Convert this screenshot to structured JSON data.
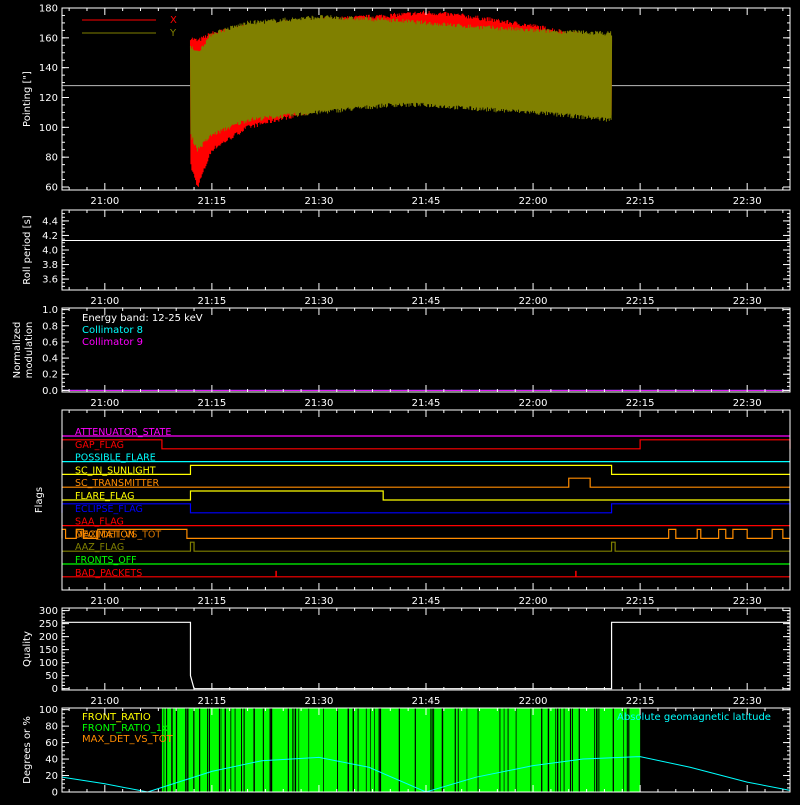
{
  "colors": {
    "background": "#000000",
    "axes": "#ffffff",
    "x_series": "#ff0000",
    "y_series": "#808000",
    "cyan": "#00ffff",
    "magenta": "#ff00ff",
    "green": "#00ff00",
    "orange": "#ff8c00",
    "yellow": "#ffff00",
    "blue": "#0000ff",
    "red": "#ff0000"
  },
  "chart_data": [
    {
      "type": "line",
      "id": "pointing",
      "ylabel": "Pointing [\"]",
      "xlim": [
        "20:54",
        "22:36"
      ],
      "ylim": [
        58,
        180
      ],
      "yticks": [
        60,
        80,
        100,
        120,
        140,
        160,
        180
      ],
      "xticks": [
        "21:00",
        "21:15",
        "21:30",
        "21:45",
        "22:00",
        "22:15",
        "22:30"
      ],
      "reference_line": 128,
      "series": [
        {
          "name": "X",
          "color": "#ff0000",
          "x": [
            "21:12",
            "21:13",
            "21:15",
            "21:20",
            "21:30",
            "21:40",
            "21:45",
            "21:50",
            "22:00",
            "22:11"
          ],
          "upper": [
            160,
            158,
            163,
            168,
            172,
            175,
            177,
            175,
            168,
            158
          ],
          "lower": [
            75,
            60,
            85,
            100,
            112,
            122,
            124,
            124,
            118,
            108
          ]
        },
        {
          "name": "Y",
          "color": "#808000",
          "x": [
            "21:12",
            "21:13",
            "21:15",
            "21:20",
            "21:30",
            "21:40",
            "21:45",
            "21:50",
            "22:00",
            "22:11"
          ],
          "upper": [
            155,
            150,
            163,
            170,
            174,
            172,
            170,
            168,
            165,
            163
          ],
          "lower": [
            95,
            85,
            95,
            105,
            110,
            115,
            115,
            113,
            110,
            105
          ]
        }
      ]
    },
    {
      "type": "line",
      "id": "roll",
      "ylabel": "Roll period [s]",
      "xlim": [
        "20:54",
        "22:36"
      ],
      "ylim": [
        3.45,
        4.55
      ],
      "yticks": [
        "3.6",
        "3.8",
        "4.0",
        "4.2",
        "4.4"
      ],
      "xticks": [
        "21:00",
        "21:15",
        "21:30",
        "21:45",
        "22:00",
        "22:15",
        "22:30"
      ],
      "series": [
        {
          "color": "#ffffff",
          "x": [
            "20:54",
            "22:36"
          ],
          "y": [
            4.13,
            4.13
          ]
        }
      ]
    },
    {
      "type": "line",
      "id": "modulation",
      "ylabel_lines": [
        "Normalized",
        "modulation"
      ],
      "xlim": [
        "20:54",
        "22:36"
      ],
      "ylim": [
        -0.02,
        1.02
      ],
      "yticks": [
        "0.0",
        "0.2",
        "0.4",
        "0.6",
        "0.8",
        "1.0"
      ],
      "xticks": [
        "21:00",
        "21:15",
        "21:30",
        "21:45",
        "22:00",
        "22:15",
        "22:30"
      ],
      "annotation": "Energy band: 12-25 keV",
      "series": [
        {
          "name": "Collimator 8",
          "color": "#00ffff",
          "x": [
            "20:54",
            "22:36"
          ],
          "y": [
            0,
            0
          ]
        },
        {
          "name": "Collimator 9",
          "color": "#ff00ff",
          "x": [
            "20:54",
            "22:36"
          ],
          "y": [
            0,
            0
          ]
        }
      ]
    },
    {
      "type": "table",
      "id": "flags",
      "ylabel": "Flags",
      "xlim": [
        "20:54",
        "22:36"
      ],
      "xticks": [
        "21:00",
        "21:15",
        "21:30",
        "21:45",
        "22:00",
        "22:15",
        "22:30"
      ],
      "flags": [
        {
          "name": "ATTENUATOR_STATE",
          "color": "#ff00ff",
          "high": []
        },
        {
          "name": "GAP_FLAG",
          "color": "#ff0000",
          "high": [
            [
              "20:54",
              "21:08"
            ],
            [
              "22:15",
              "22:36"
            ]
          ]
        },
        {
          "name": "POSSIBLE_FLARE",
          "color": "#00ffff",
          "high": []
        },
        {
          "name": "SC_IN_SUNLIGHT",
          "color": "#ffff00",
          "high": [
            [
              "21:12",
              "22:11"
            ]
          ]
        },
        {
          "name": "SC_TRANSMITTER",
          "color": "#ff8c00",
          "high": [
            [
              "22:05",
              "22:08"
            ]
          ]
        },
        {
          "name": "FLARE_FLAG",
          "color": "#ffff00",
          "high": [
            [
              "21:12",
              "21:39"
            ]
          ]
        },
        {
          "name": "ECLIPSE_FLAG",
          "color": "#0000ff",
          "high": [
            [
              "20:54",
              "21:12"
            ],
            [
              "22:11",
              "22:36"
            ]
          ]
        },
        {
          "name": "SAA_FLAG",
          "color": "#ff0000",
          "high": []
        },
        {
          "name": "DECIMATION",
          "color": "#ff8c00",
          "high": [
            [
              "20:54",
              "20:54.5"
            ],
            [
              "20:56",
              "20:57"
            ],
            [
              "20:59",
              "21:11.5"
            ],
            [
              "22:19",
              "22:20"
            ],
            [
              "22:23",
              "22:23.5"
            ],
            [
              "22:26",
              "22:27"
            ],
            [
              "22:28",
              "22:30"
            ],
            [
              "22:33.5",
              "22:35"
            ]
          ]
        },
        {
          "name": "AAZ_FLAG",
          "color": "#808000",
          "high": [
            [
              "21:12",
              "21:12.5"
            ],
            [
              "22:11",
              "22:11.5"
            ]
          ]
        },
        {
          "name": "FRONTS_OFF",
          "color": "#00ff00",
          "high": []
        },
        {
          "name": "BAD_PACKETS",
          "color": "#ff0000",
          "spikes": [
            "21:24",
            "22:06"
          ]
        }
      ],
      "overlap_label": {
        "text": "MAX_DET_VS_TOT",
        "color": "#ff8c00"
      }
    },
    {
      "type": "line",
      "id": "quality",
      "ylabel": "Quality",
      "xlim": [
        "20:54",
        "22:36"
      ],
      "ylim": [
        -5,
        310
      ],
      "yticks": [
        0,
        50,
        100,
        150,
        200,
        250,
        300
      ],
      "xticks": [
        "21:00",
        "21:15",
        "21:30",
        "21:45",
        "22:00",
        "22:15",
        "22:30"
      ],
      "series": [
        {
          "color": "#ffffff",
          "x": [
            "20:54",
            "21:12",
            "21:12",
            "21:12.5",
            "22:11",
            "22:11",
            "22:36"
          ],
          "y": [
            255,
            255,
            50,
            0,
            0,
            255,
            255
          ]
        }
      ]
    },
    {
      "type": "line",
      "id": "ratios",
      "ylabel": "Degrees or %",
      "xlim": [
        "20:54",
        "22:36"
      ],
      "ylim": [
        0,
        102
      ],
      "yticks": [
        0,
        20,
        40,
        60,
        80,
        100
      ],
      "legend": [
        {
          "name": "FRONT_RATIO",
          "color": "#ffff00"
        },
        {
          "name": "FRONT_RATIO_1x",
          "color": "#00ff00"
        },
        {
          "name": "MAX_DET_VS_TOT",
          "color": "#ff8c00"
        }
      ],
      "latitude_label": "Absolute geomagnetic latitude",
      "green_region": [
        "21:08",
        "22:15"
      ],
      "latitude": {
        "color": "#00ffff",
        "x": [
          "20:54",
          "21:00",
          "21:06",
          "21:15",
          "21:22",
          "21:30",
          "21:37",
          "21:45",
          "21:52",
          "22:00",
          "22:07",
          "22:15",
          "22:22",
          "22:30",
          "22:36"
        ],
        "y": [
          18,
          10,
          0,
          25,
          38,
          42,
          30,
          0,
          18,
          32,
          40,
          43,
          30,
          12,
          2
        ]
      }
    }
  ]
}
